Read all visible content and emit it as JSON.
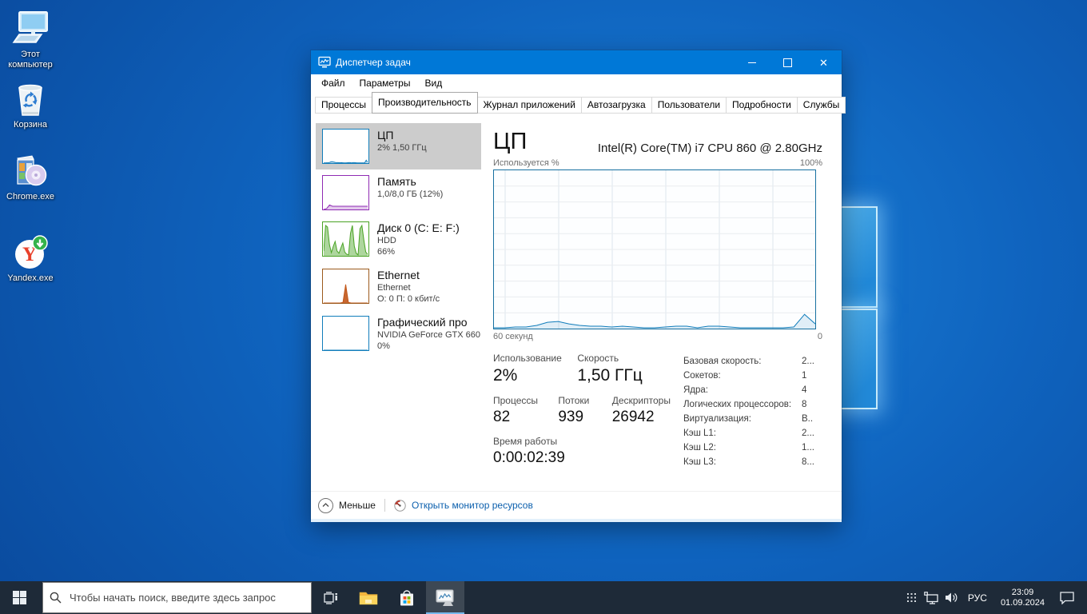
{
  "desktop": {
    "icons": [
      {
        "label": "Этот компьютер"
      },
      {
        "label": "Корзина"
      },
      {
        "label": "Chrome.exe"
      },
      {
        "label": "Yandex.exe"
      }
    ]
  },
  "window": {
    "title": "Диспетчер задач",
    "menu": {
      "file": "Файл",
      "options": "Параметры",
      "view": "Вид"
    },
    "tabs": [
      {
        "label": "Процессы"
      },
      {
        "label": "Производительность"
      },
      {
        "label": "Журнал приложений"
      },
      {
        "label": "Автозагрузка"
      },
      {
        "label": "Пользователи"
      },
      {
        "label": "Подробности"
      },
      {
        "label": "Службы"
      }
    ],
    "active_tab": "Производительность",
    "sidebar": {
      "items": [
        {
          "title": "ЦП",
          "line1": "2% 1,50 ГГц",
          "line2": "",
          "color": "#117dbb",
          "selected": true
        },
        {
          "title": "Память",
          "line1": "1,0/8,0 ГБ (12%)",
          "line2": "",
          "color": "#8f2bb3",
          "selected": false
        },
        {
          "title": "Диск 0 (C: E: F:)",
          "line1": "HDD",
          "line2": "66%",
          "color": "#4aa325",
          "selected": false
        },
        {
          "title": "Ethernet",
          "line1": "Ethernet",
          "line2": "О: 0 П: 0 кбит/с",
          "color": "#9c5a1d",
          "selected": false
        },
        {
          "title": "Графический про",
          "line1": "NVIDIA GeForce GTX 660",
          "line2": "0%",
          "color": "#117dbb",
          "selected": false
        }
      ]
    },
    "main": {
      "title": "ЦП",
      "subtitle": "Intel(R) Core(TM) i7 CPU 860 @ 2.80GHz",
      "graph": {
        "top_left": "Используется %",
        "top_right": "100%",
        "bottom_left": "60 секунд",
        "bottom_right": "0"
      },
      "stats": {
        "usage_label": "Использование",
        "usage_value": "2%",
        "speed_label": "Скорость",
        "speed_value": "1,50 ГГц",
        "processes_label": "Процессы",
        "processes_value": "82",
        "threads_label": "Потоки",
        "threads_value": "939",
        "handles_label": "Дескрипторы",
        "handles_value": "26942",
        "uptime_label": "Время работы",
        "uptime_value": "0:00:02:39"
      },
      "info": [
        {
          "label": "Базовая скорость:",
          "value": "2..."
        },
        {
          "label": "Сокетов:",
          "value": "1"
        },
        {
          "label": "Ядра:",
          "value": "4"
        },
        {
          "label": "Логических процессоров:",
          "value": "8"
        },
        {
          "label": "Виртуализация:",
          "value": "В.."
        },
        {
          "label": "Кэш L1:",
          "value": "2..."
        },
        {
          "label": "Кэш L2:",
          "value": "1..."
        },
        {
          "label": "Кэш L3:",
          "value": "8..."
        }
      ]
    },
    "footer": {
      "less": "Меньше",
      "resmon": "Открыть монитор ресурсов"
    }
  },
  "taskbar": {
    "search_placeholder": "Чтобы начать поиск, введите здесь запрос",
    "tray": {
      "lang": "РУС",
      "time": "23:09",
      "date": "01.09.2024"
    }
  },
  "colors": {
    "accent_titlebar": "#0078d7",
    "taskbar_bg": "#1e2a38",
    "cpu": "#117dbb",
    "memory": "#8f2bb3",
    "disk": "#4aa325",
    "ethernet": "#9c5a1d",
    "link": "#0b5fad",
    "selected_item_bg": "#cccccc"
  },
  "chart_data": [
    {
      "id": "cpu-usage-history",
      "type": "area",
      "title": "ЦП — Используется %",
      "xlabel": "60 секунд → 0",
      "ylabel": "Используется %",
      "x_range_seconds": [
        60,
        0
      ],
      "ylim": [
        0,
        100
      ],
      "grid": true,
      "legend": "none",
      "color": "#117dbb",
      "fill_opacity": 0.12,
      "values": [
        0.5,
        0.5,
        1,
        1,
        2,
        4,
        4.5,
        3,
        2,
        1.5,
        1.5,
        1,
        1.5,
        1,
        0.5,
        0.5,
        1,
        1.5,
        1.5,
        0.5,
        1.5,
        1.5,
        1,
        0.5,
        0.5,
        0.5,
        0.5,
        0.5,
        1,
        9,
        3
      ]
    },
    {
      "id": "cpu-mini",
      "type": "area",
      "ylim": [
        0,
        100
      ],
      "grid": false,
      "color": "#117dbb",
      "fill_opacity": 0.3,
      "values": [
        0.5,
        0.5,
        1,
        1,
        2,
        4,
        4.5,
        3,
        2,
        1.5,
        1.5,
        1,
        1.5,
        1,
        0.5,
        0.5,
        1,
        1.5,
        1.5,
        0.5,
        1.5,
        1.5,
        1,
        0.5,
        0.5,
        0.5,
        0.5,
        0.5,
        1,
        9,
        3
      ]
    },
    {
      "id": "memory-mini",
      "type": "area",
      "ylim": [
        0,
        100
      ],
      "grid": false,
      "color": "#8f2bb3",
      "fill_opacity": 0.25,
      "values": [
        0,
        3,
        14,
        10,
        10,
        10,
        10,
        10,
        10,
        10,
        10,
        10,
        10,
        10,
        10,
        10
      ]
    },
    {
      "id": "disk-mini",
      "type": "area",
      "ylim": [
        0,
        100
      ],
      "grid": false,
      "color": "#4aa325",
      "fill_opacity": 0.45,
      "values": [
        15,
        95,
        90,
        35,
        10,
        30,
        45,
        15,
        8,
        25,
        40,
        12,
        5,
        3,
        70,
        95,
        30,
        8,
        3,
        85,
        95,
        50,
        12,
        5
      ]
    },
    {
      "id": "ethernet-mini",
      "type": "area",
      "ylim": [
        0,
        100
      ],
      "grid": false,
      "color": "#c2571a",
      "fill_opacity": 0.9,
      "values": [
        0,
        0,
        0,
        0,
        0,
        0,
        0,
        2,
        58,
        2,
        0,
        0,
        0,
        0,
        0,
        0,
        0
      ]
    },
    {
      "id": "gpu-mini",
      "type": "area",
      "ylim": [
        0,
        100
      ],
      "grid": false,
      "color": "#117dbb",
      "fill_opacity": 0.3,
      "values": [
        0,
        0
      ]
    }
  ]
}
